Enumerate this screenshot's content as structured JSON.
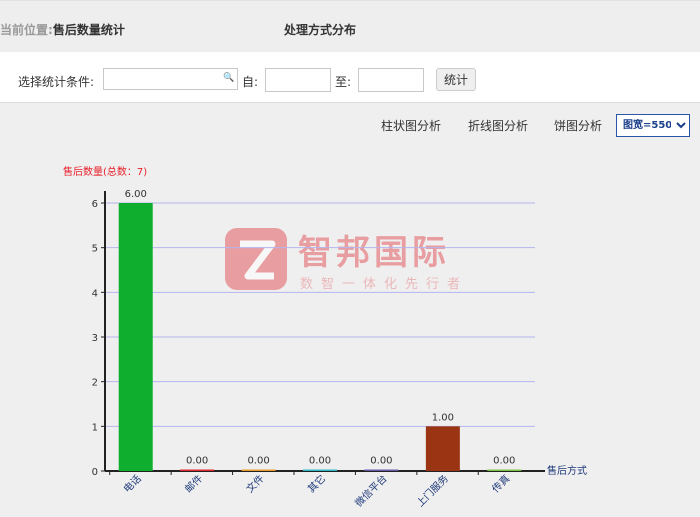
{
  "breadcrumb": {
    "label": "当前位置:",
    "current": "售后数量统计"
  },
  "panel_title": "处理方式分布",
  "filters": {
    "condition_label": "选择统计条件:",
    "search_value": "",
    "from_label": "自:",
    "from_value": "",
    "to_label": "至:",
    "to_value": "",
    "submit_label": "统计"
  },
  "toolbar": {
    "bar_label": "柱状图分析",
    "line_label": "折线图分析",
    "pie_label": "饼图分析",
    "width_select": {
      "selected": "图宽=550",
      "options": [
        "图宽=550"
      ]
    }
  },
  "watermark": {
    "name": "智邦国际",
    "slogan": "数智一体化先行者"
  },
  "chart_data": {
    "type": "bar",
    "title": "售后数量(总数：7)",
    "xlabel": "售后方式",
    "ylabel": "",
    "ylim": [
      0,
      6
    ],
    "yticks": [
      0,
      1,
      2,
      3,
      4,
      5,
      6
    ],
    "grid": true,
    "categories": [
      "电话",
      "邮件",
      "文件",
      "其它",
      "微信平台",
      "上门服务",
      "传真"
    ],
    "values": [
      6,
      0,
      0,
      0,
      0,
      1,
      0
    ],
    "value_labels": [
      "6.00",
      "0.00",
      "0.00",
      "0.00",
      "0.00",
      "1.00",
      "0.00"
    ],
    "colors": [
      "#0fae2e",
      "#e0262e",
      "#e89a2c",
      "#2fb7c8",
      "#6a5aa8",
      "#9a3412",
      "#7cc242"
    ]
  }
}
